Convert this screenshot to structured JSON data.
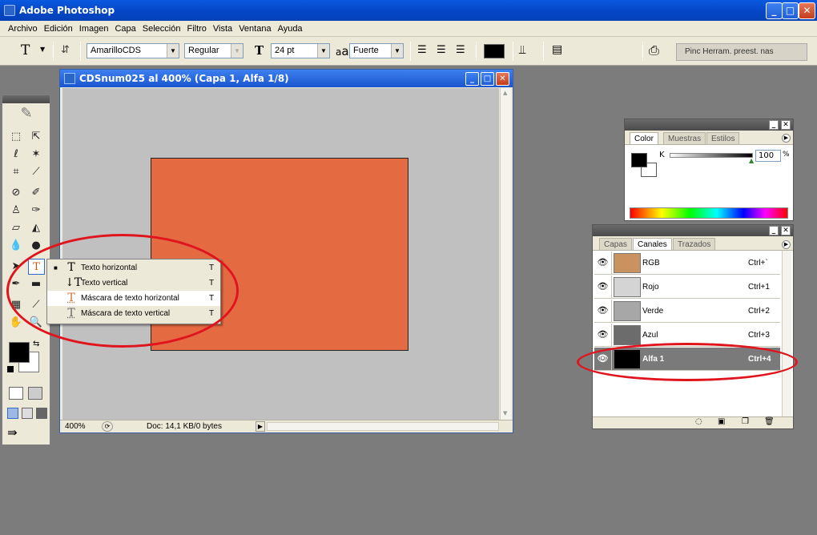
{
  "app": {
    "title": "Adobe Photoshop"
  },
  "menu": [
    "Archivo",
    "Edición",
    "Imagen",
    "Capa",
    "Selección",
    "Filtro",
    "Vista",
    "Ventana",
    "Ayuda"
  ],
  "options": {
    "tool_glyph": "T",
    "font_family": "AmarilloCDS",
    "font_style": "Regular",
    "font_size": "24 pt",
    "aa_glyph": "a",
    "antialias": "Fuerte",
    "color_swatch": "#000000",
    "palette_tabs": "Pinc Herram. preest. nas"
  },
  "document": {
    "title": "CDSnum025 al 400% (Capa 1, Alfa 1/8)",
    "zoom": "400%",
    "doc_info": "Doc: 14,1 KB/0 bytes",
    "layer_color": "#e46a42",
    "canvas_color": "#c0c0c0"
  },
  "toolbox": {
    "foreground": "#000000",
    "background": "#ffffff"
  },
  "type_flyout": {
    "items": [
      {
        "label": "Texto horizontal",
        "key": "T",
        "selected": true
      },
      {
        "label": "Texto vertical",
        "key": "T",
        "selected": false
      },
      {
        "label": "Máscara de texto horizontal",
        "key": "T",
        "selected": false
      },
      {
        "label": "Máscara de texto vertical",
        "key": "T",
        "selected": false
      }
    ]
  },
  "color_panel": {
    "tabs": [
      "Color",
      "Muestras",
      "Estilos"
    ],
    "channel_label": "K",
    "value": "100",
    "unit": "%",
    "slider_level": 1.0
  },
  "channels_panel": {
    "tabs": [
      "Capas",
      "Canales",
      "Trazados"
    ],
    "rows": [
      {
        "name": "RGB",
        "key": "Ctrl+`",
        "thumb": "#c9925e",
        "highlighted": false
      },
      {
        "name": "Rojo",
        "key": "Ctrl+1",
        "thumb": "#d4d4d4",
        "highlighted": false
      },
      {
        "name": "Verde",
        "key": "Ctrl+2",
        "thumb": "#a7a7a7",
        "highlighted": false
      },
      {
        "name": "Azul",
        "key": "Ctrl+3",
        "thumb": "#6c6c6c",
        "highlighted": false
      },
      {
        "name": "Alfa 1",
        "key": "Ctrl+4",
        "thumb": "#000000",
        "highlighted": true
      }
    ]
  },
  "annotation_color": "#e0141d"
}
